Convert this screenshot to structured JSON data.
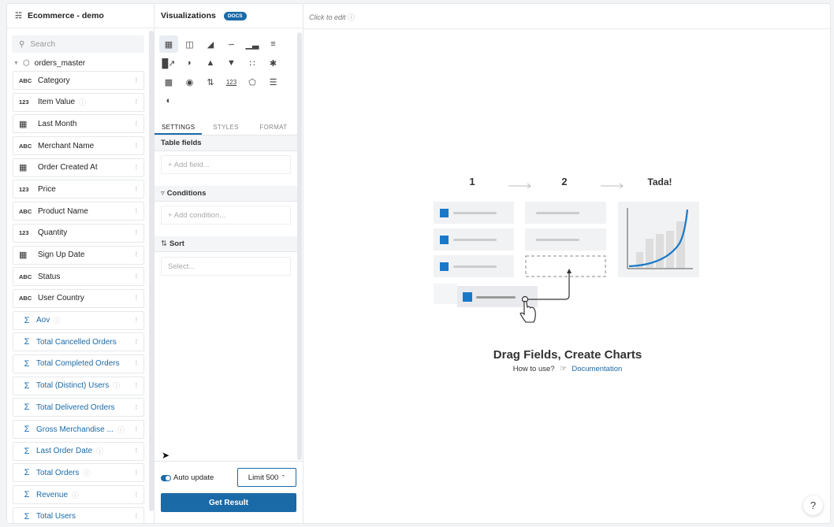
{
  "left": {
    "title": "Ecommerce - demo",
    "search_placeholder": "Search",
    "model": "orders_master",
    "fields": [
      {
        "type": "ABC",
        "name": "Category",
        "kind": "dim",
        "info": false
      },
      {
        "type": "123",
        "name": "Item Value",
        "kind": "dim",
        "info": true
      },
      {
        "type": "cal",
        "name": "Last Month",
        "kind": "dim",
        "info": false
      },
      {
        "type": "ABC",
        "name": "Merchant Name",
        "kind": "dim",
        "info": false
      },
      {
        "type": "cal",
        "name": "Order Created At",
        "kind": "dim",
        "info": false
      },
      {
        "type": "123",
        "name": "Price",
        "kind": "dim",
        "info": false
      },
      {
        "type": "ABC",
        "name": "Product Name",
        "kind": "dim",
        "info": false
      },
      {
        "type": "123",
        "name": "Quantity",
        "kind": "dim",
        "info": false
      },
      {
        "type": "cal",
        "name": "Sign Up Date",
        "kind": "dim",
        "info": false
      },
      {
        "type": "ABC",
        "name": "Status",
        "kind": "dim",
        "info": false
      },
      {
        "type": "ABC",
        "name": "User Country",
        "kind": "dim",
        "info": false
      },
      {
        "type": "Σ",
        "name": "Aov",
        "kind": "measure",
        "info": true
      },
      {
        "type": "Σ",
        "name": "Total Cancelled Orders",
        "kind": "measure",
        "info": false
      },
      {
        "type": "Σ",
        "name": "Total Completed Orders",
        "kind": "measure",
        "info": false
      },
      {
        "type": "Σ",
        "name": "Total (Distinct) Users",
        "kind": "measure",
        "info": true
      },
      {
        "type": "Σ",
        "name": "Total Delivered Orders",
        "kind": "measure",
        "info": false
      },
      {
        "type": "Σ",
        "name": "Gross Merchandise ...",
        "kind": "measure",
        "info": true
      },
      {
        "type": "Σ",
        "name": "Last Order Date",
        "kind": "measure",
        "info": true
      },
      {
        "type": "Σ",
        "name": "Total Orders",
        "kind": "measure",
        "info": true
      },
      {
        "type": "Σ",
        "name": "Revenue",
        "kind": "measure",
        "info": true
      },
      {
        "type": "Σ",
        "name": "Total Users",
        "kind": "measure",
        "info": false
      }
    ]
  },
  "mid": {
    "title": "Visualizations",
    "docs_badge": "DOCS",
    "viz_icons": [
      "table",
      "pivot",
      "area",
      "line",
      "column",
      "bar",
      "combo",
      "pie",
      "pyramid",
      "funnel",
      "scatter",
      "bubble",
      "heatmap",
      "map",
      "sort",
      "number",
      "radar",
      "progress",
      "gauge"
    ],
    "tabs": [
      "SETTINGS",
      "STYLES",
      "FORMAT"
    ],
    "sections": {
      "table_fields": "Table fields",
      "add_field": "+ Add field...",
      "conditions": "Conditions",
      "add_condition": "+ Add condition...",
      "sort": "Sort",
      "sort_select": "Select..."
    },
    "auto_update": "Auto update",
    "auto_update_on": true,
    "limit": "Limit 500",
    "get_result": "Get Result"
  },
  "main": {
    "click_to_edit": "Click to edit",
    "steps": [
      "1",
      "2",
      "Tada!"
    ],
    "headline": "Drag Fields, Create Charts",
    "how_to": "How to use?",
    "doc_link": "Documentation"
  },
  "help": "?"
}
